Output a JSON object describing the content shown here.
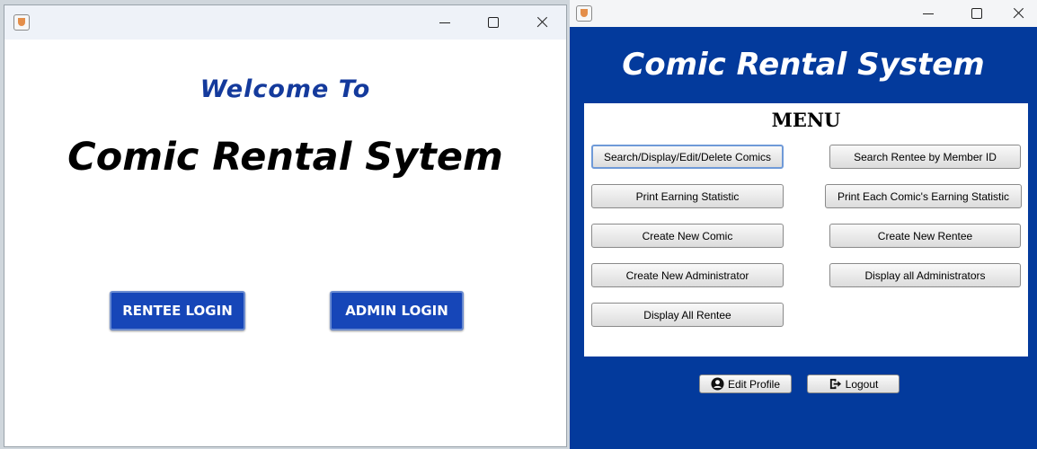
{
  "login_window": {
    "welcome_text": "Welcome To",
    "title_text": "Comic Rental Sytem",
    "rentee_login_label": "RENTEE LOGIN",
    "admin_login_label": "ADMIN LOGIN",
    "icons": [
      "java-app-icon",
      "minimize-icon",
      "maximize-icon",
      "close-icon"
    ]
  },
  "menu_window": {
    "system_title": "Comic Rental System",
    "menu_heading": "MENU",
    "buttons": {
      "search_comics": "Search/Display/Edit/Delete Comics",
      "search_rentee": "Search Rentee by Member ID",
      "print_earning": "Print Earning Statistic",
      "print_each_comic": "Print Each Comic's Earning Statistic",
      "create_comic": "Create New Comic",
      "create_rentee": "Create New Rentee",
      "create_admin": "Create New Administrator",
      "display_admins": "Display all Administrators",
      "display_rentees": "Display All Rentee"
    },
    "footer": {
      "edit_profile": "Edit Profile",
      "logout": "Logout"
    },
    "icons": [
      "java-app-icon",
      "minimize-icon",
      "maximize-icon",
      "close-icon",
      "user-icon",
      "logout-icon"
    ]
  },
  "colors": {
    "brand_blue": "#033a9c",
    "button_blue": "#1646b8",
    "welcome_blue": "#143a9c"
  }
}
